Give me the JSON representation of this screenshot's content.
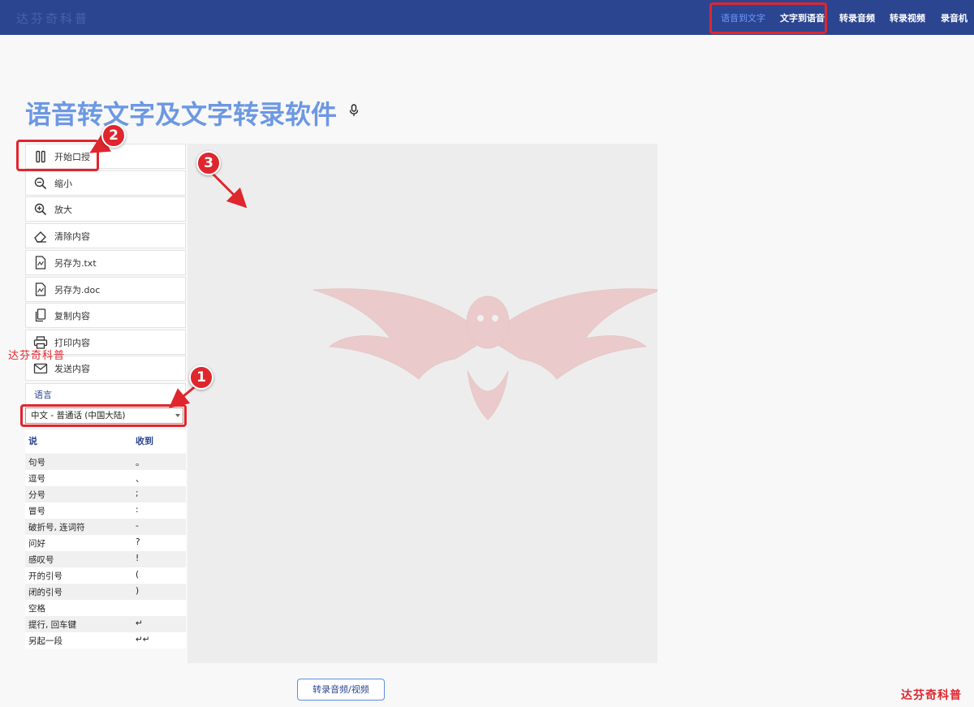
{
  "header": {
    "logo_text": "达芬奇科普",
    "nav": [
      {
        "label": "语音到文字",
        "active": true
      },
      {
        "label": "文字到语音",
        "active": false
      },
      {
        "label": "转录音频",
        "active": false
      },
      {
        "label": "转录视频",
        "active": false
      },
      {
        "label": "录音机",
        "active": false
      }
    ]
  },
  "main": {
    "title": "语音转文字及文字转录软件",
    "tools": [
      {
        "label": "开始口授",
        "icon": "pause-icon"
      },
      {
        "label": "缩小",
        "icon": "zoom-out-icon"
      },
      {
        "label": "放大",
        "icon": "zoom-in-icon"
      },
      {
        "label": "清除内容",
        "icon": "eraser-icon"
      },
      {
        "label": "另存为.txt",
        "icon": "save-txt-icon"
      },
      {
        "label": "另存为.doc",
        "icon": "save-doc-icon"
      },
      {
        "label": "复制内容",
        "icon": "copy-icon"
      },
      {
        "label": "打印内容",
        "icon": "print-icon"
      },
      {
        "label": "发送内容",
        "icon": "mail-icon"
      }
    ],
    "language_label": "语言",
    "language_selected": "中文 - 普通话 (中国大陆)",
    "punct_header": {
      "say": "说",
      "get": "收到"
    },
    "punctuation": [
      {
        "say": "句号",
        "get": "。"
      },
      {
        "say": "逗号",
        "get": "、"
      },
      {
        "say": "分号",
        "get": ";"
      },
      {
        "say": "冒号",
        "get": ":"
      },
      {
        "say": "破折号, 连词符",
        "get": "-"
      },
      {
        "say": "问好",
        "get": "?"
      },
      {
        "say": "感叹号",
        "get": "!"
      },
      {
        "say": "开的引号",
        "get": "("
      },
      {
        "say": "闭的引号",
        "get": ")"
      },
      {
        "say": "空格",
        "get": ""
      },
      {
        "say": "提行, 回车键",
        "get": "↵"
      },
      {
        "say": "另起一段",
        "get": "↵↵"
      }
    ],
    "transcribe_button": "转录音频/视频"
  },
  "annotations": {
    "watermark_left": "达芬奇科普",
    "watermark_bottom": "达芬奇科普",
    "badges": [
      "1",
      "2",
      "3"
    ]
  },
  "colors": {
    "nav_bg": "#2b4591",
    "title": "#6c98e3",
    "nav_active": "#6d99ff",
    "callout_red": "#e0262d",
    "editor_bg": "#ededed"
  }
}
